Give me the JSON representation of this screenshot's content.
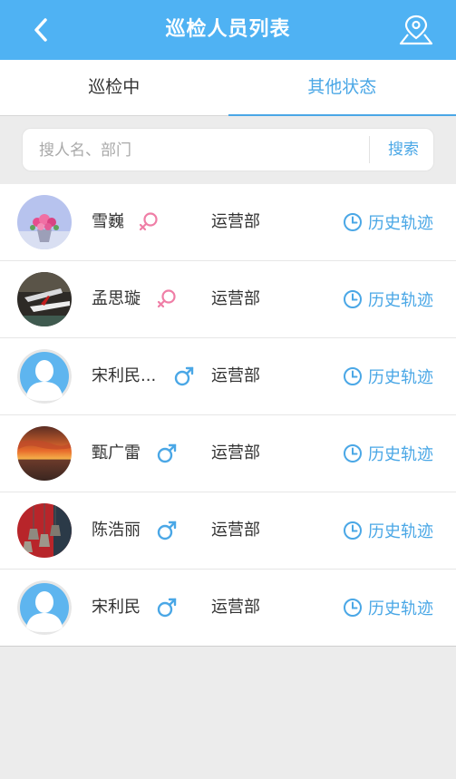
{
  "header": {
    "title": "巡检人员列表",
    "back_icon": "back-chevron-icon",
    "location_icon": "location-person-icon"
  },
  "tabs": [
    {
      "label": "巡检中",
      "active": false
    },
    {
      "label": "其他状态",
      "active": true
    }
  ],
  "search": {
    "placeholder": "搜人名、部门",
    "value": "",
    "button_label": "搜索"
  },
  "colors": {
    "accent": "#4fb2f3",
    "link": "#4aa7e6",
    "female": "#ef7ea6",
    "male": "#4aa7e6"
  },
  "people": [
    {
      "name": "雪巍",
      "gender": "female",
      "department": "运营部",
      "history_label": "历史轨迹",
      "avatar": "flower-photo"
    },
    {
      "name": "孟思璇",
      "gender": "female",
      "department": "运营部",
      "history_label": "历史轨迹",
      "avatar": "airplane-photo"
    },
    {
      "name": "宋利民...",
      "gender": "male",
      "department": "运营部",
      "history_label": "历史轨迹",
      "avatar": "default-avatar"
    },
    {
      "name": "甄广雷",
      "gender": "male",
      "department": "运营部",
      "history_label": "历史轨迹",
      "avatar": "sunset-photo"
    },
    {
      "name": "陈浩丽",
      "gender": "male",
      "department": "运营部",
      "history_label": "历史轨迹",
      "avatar": "bells-photo"
    },
    {
      "name": "宋利民",
      "gender": "male",
      "department": "运营部",
      "history_label": "历史轨迹",
      "avatar": "default-avatar"
    }
  ]
}
